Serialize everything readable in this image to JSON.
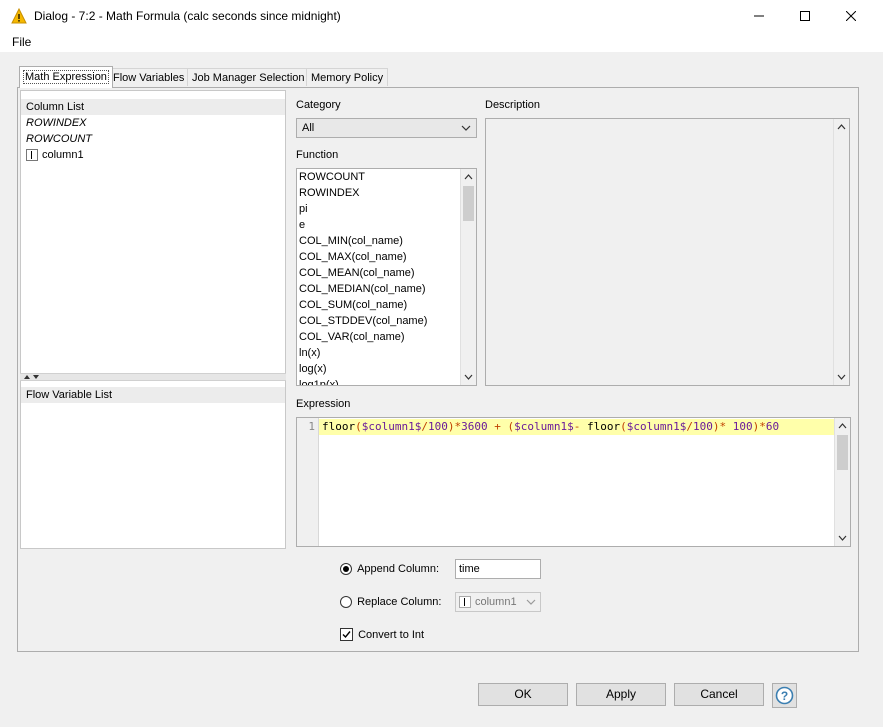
{
  "window": {
    "title": "Dialog - 7:2 - Math Formula (calc seconds since midnight)",
    "minimize_glyph": "—",
    "maximize_glyph": "☐",
    "close_glyph": "✕"
  },
  "menu": {
    "file": "File"
  },
  "tabs": [
    {
      "label": "Math Expression",
      "active": true
    },
    {
      "label": "Flow Variables",
      "active": false
    },
    {
      "label": "Job Manager Selection",
      "active": false
    },
    {
      "label": "Memory Policy",
      "active": false
    }
  ],
  "column_list": {
    "header": "Column List",
    "items": [
      {
        "label": "ROWINDEX",
        "italic": true
      },
      {
        "label": "ROWCOUNT",
        "italic": true
      },
      {
        "label": "column1",
        "type_icon": "integer-column-icon"
      }
    ]
  },
  "flow_variable_list": {
    "header": "Flow Variable List"
  },
  "category": {
    "label": "Category",
    "selected": "All"
  },
  "function": {
    "label": "Function",
    "items": [
      "ROWCOUNT",
      "ROWINDEX",
      "pi",
      "e",
      "COL_MIN(col_name)",
      "COL_MAX(col_name)",
      "COL_MEAN(col_name)",
      "COL_MEDIAN(col_name)",
      "COL_SUM(col_name)",
      "COL_STDDEV(col_name)",
      "COL_VAR(col_name)",
      "ln(x)",
      "log(x)",
      "log1p(x)"
    ]
  },
  "description": {
    "label": "Description"
  },
  "expression": {
    "label": "Expression",
    "line_number": "1",
    "code": "floor($column1$/100)*3600 + ($column1$- floor($column1$/100)* 100)*60"
  },
  "options": {
    "append_label": "Append Column:",
    "append_value": "time",
    "append_selected": true,
    "replace_label": "Replace Column:",
    "replace_value": "column1",
    "convert_label": "Convert to Int",
    "convert_checked": true
  },
  "buttons": {
    "ok": "OK",
    "apply": "Apply",
    "cancel": "Cancel",
    "help": "?"
  },
  "colors": {
    "accent": "#3c7fb1",
    "highlight": "#ffffaa",
    "warning_icon": "#f5b800"
  }
}
